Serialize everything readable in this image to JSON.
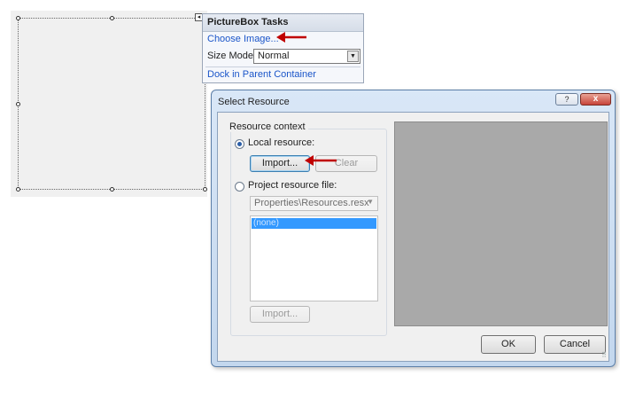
{
  "tasks_panel": {
    "title": "PictureBox Tasks",
    "choose_image_link": "Choose Image...",
    "size_mode_label": "Size Mode:",
    "size_mode_value": "Normal",
    "dock_link": "Dock in Parent Container"
  },
  "dialog": {
    "title": "Select Resource",
    "help_label": "?",
    "close_label": "x",
    "resource_context": {
      "legend": "Resource context",
      "local_resource_label": "Local resource:",
      "local_resource_checked": true,
      "import_button": "Import...",
      "clear_button": "Clear",
      "project_resource_label": "Project resource file:",
      "project_resource_checked": false,
      "resource_file_value": "Properties\\Resources.resx",
      "list_items": [
        "(none)"
      ],
      "project_import_button": "Import..."
    },
    "ok_button": "OK",
    "cancel_button": "Cancel"
  },
  "colors": {
    "annotation_arrow": "#c00000",
    "link": "#1a55c9",
    "list_selection": "#3399ff"
  }
}
